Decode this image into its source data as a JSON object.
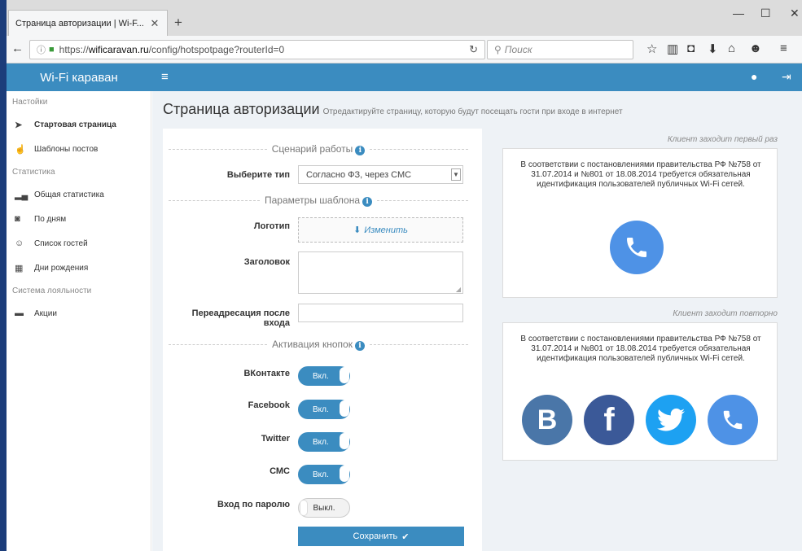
{
  "browser": {
    "tab_title": "Страница авторизации | Wi-F...",
    "tab_close": "✕",
    "new_tab": "+",
    "url_prefix": "https://",
    "url_domain": "wificaravan.ru",
    "url_path": "/config/hotspotpage?routerId=0",
    "search_placeholder": "Поиск"
  },
  "app": {
    "brand": "Wi-Fi караван"
  },
  "sidebar": {
    "sections": [
      "Настойки",
      "Статистика",
      "Система лояльности"
    ],
    "items": [
      {
        "label": "Стартовая страница",
        "icon": "paper-plane-icon"
      },
      {
        "label": "Шаблоны постов",
        "icon": "thumbs-up-icon"
      },
      {
        "label": "Общая статистика",
        "icon": "bar-chart-icon"
      },
      {
        "label": "По дням",
        "icon": "binoculars-icon"
      },
      {
        "label": "Список гостей",
        "icon": "users-icon"
      },
      {
        "label": "Дни рождения",
        "icon": "calendar-icon"
      },
      {
        "label": "Акции",
        "icon": "ticket-icon"
      }
    ]
  },
  "page": {
    "title": "Страница авторизации",
    "subtitle": "Отредактируйте страницу, которую будут посещать гости при входе в интернет"
  },
  "form": {
    "scenario_heading": "Сценарий работы",
    "type_label": "Выберите тип",
    "type_value": "Согласно ФЗ, через СМС",
    "template_heading": "Параметры шаблона",
    "logo_label": "Логотип",
    "logo_button": "Изменить",
    "header_label": "Заголовок",
    "redirect_label_1": "Переадресация после",
    "redirect_label_2": "входа",
    "buttons_heading": "Активация кнопок",
    "toggles": [
      {
        "label": "ВКонтакте",
        "state": "Вкл.",
        "on": true
      },
      {
        "label": "Facebook",
        "state": "Вкл.",
        "on": true
      },
      {
        "label": "Twitter",
        "state": "Вкл.",
        "on": true
      },
      {
        "label": "СМС",
        "state": "Вкл.",
        "on": true
      },
      {
        "label": "Вход по паролю",
        "state": "Выкл.",
        "on": false
      }
    ],
    "save_button": "Сохранить"
  },
  "preview": {
    "first_caption": "Клиент заходит первый раз",
    "repeat_caption": "Клиент заходит повторно",
    "notice": "В соответствии с постановлениями правительства РФ №758 от 31.07.2014 и №801 от 18.08.2014 требуется обязательная идентификация пользователей публичных Wi-Fi сетей."
  },
  "colors": {
    "accent": "#3b8cc0",
    "vk": "#4a76a8",
    "facebook": "#3b5998",
    "twitter": "#1da1f2",
    "phone": "#4e92e6"
  }
}
